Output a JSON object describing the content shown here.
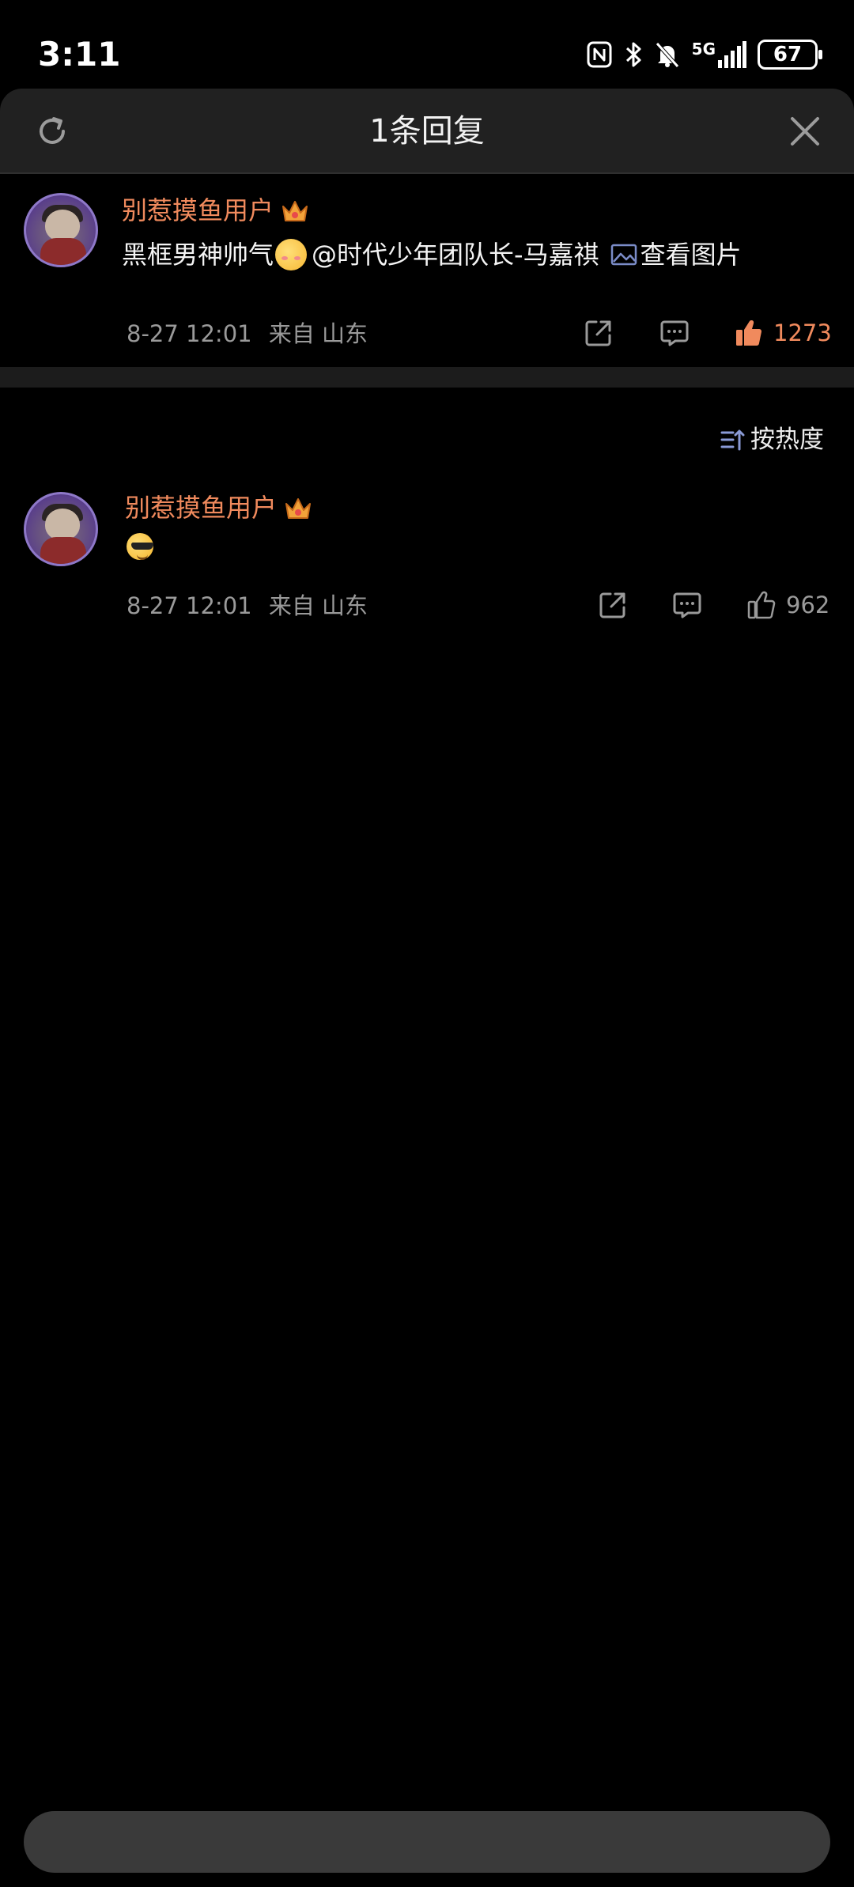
{
  "status_bar": {
    "time": "3:11",
    "network": "5G",
    "battery": "67"
  },
  "header": {
    "title": "1条回复"
  },
  "parent_comment": {
    "username": "别惹摸鱼用户",
    "text": "黑框男神帅气",
    "mention": "@时代少年团队长-马嘉祺",
    "view_image_label": "查看图片",
    "timestamp": "8-27 12:01",
    "location": "来自 山东",
    "like_count": "1273",
    "liked": true
  },
  "sort": {
    "label": "按热度"
  },
  "replies": [
    {
      "username": "别惹摸鱼用户",
      "timestamp": "8-27 12:01",
      "location": "来自 山东",
      "like_count": "962",
      "liked": false
    }
  ],
  "reply_input": {
    "placeholder": ""
  },
  "colors": {
    "background": "#000000",
    "header_bg": "#212121",
    "username": "#f08a5d",
    "meta": "#9a9a9a",
    "like_active": "#f08a5d"
  }
}
